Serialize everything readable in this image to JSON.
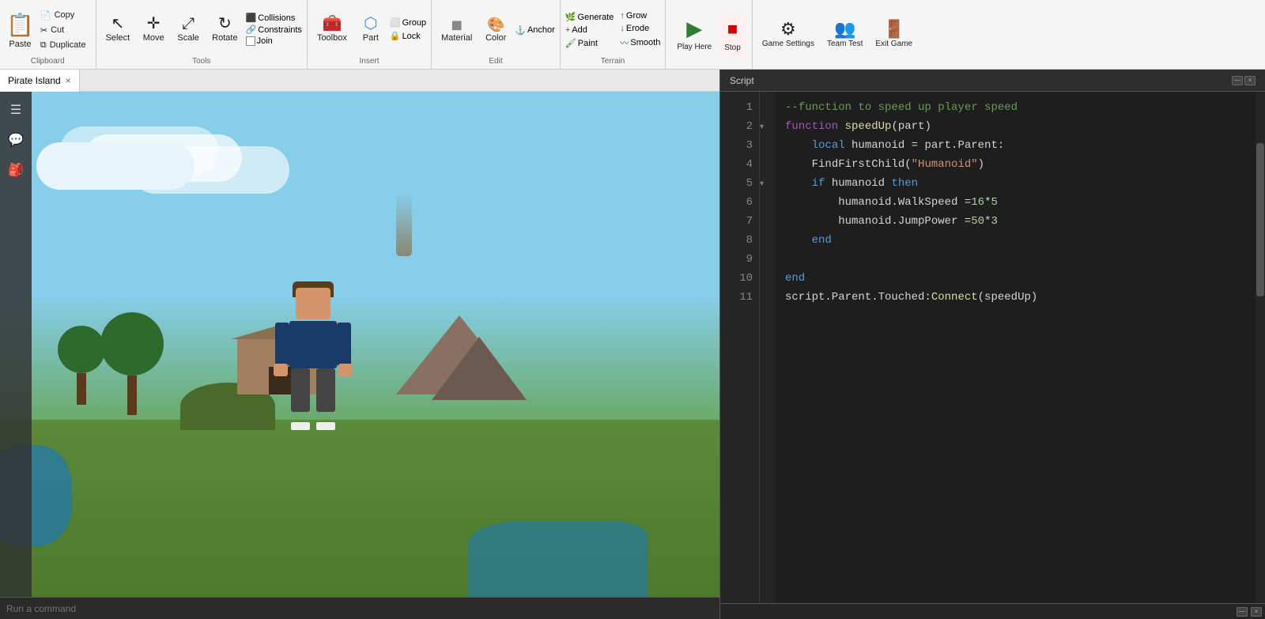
{
  "toolbar": {
    "clipboard": {
      "label": "Clipboard",
      "paste": "Paste",
      "copy": "Copy",
      "cut": "Cut",
      "duplicate": "Duplicate"
    },
    "tools": {
      "label": "Tools",
      "select": "Select",
      "move": "Move",
      "scale": "Scale",
      "rotate": "Rotate",
      "collisions": "Collisions",
      "constraints": "Constraints",
      "join": "Join"
    },
    "insert": {
      "label": "Insert",
      "toolbox": "Toolbox",
      "part": "Part",
      "group": "Group",
      "lock": "Lock"
    },
    "edit": {
      "label": "Edit",
      "material": "Material",
      "color": "Color",
      "anchor": "Anchor"
    },
    "terrain": {
      "label": "Terrain",
      "generate": "Generate",
      "grow": "Grow",
      "add": "Add",
      "erode": "Erode",
      "paint": "Paint",
      "smooth": "Smooth"
    },
    "play": {
      "play_here": "Play Here",
      "stop": "Stop",
      "game_settings": "Game Settings",
      "team_test": "Team Test",
      "exit_game": "Exit Game"
    }
  },
  "tab": {
    "name": "Pirate Island",
    "close": "×"
  },
  "viewport": {
    "sidebar_icons": [
      "☰",
      "💬",
      "🎒"
    ]
  },
  "script_panel": {
    "title": "Script",
    "lines": [
      {
        "num": 1,
        "fold": false,
        "content": "--function to speed up player speed",
        "type": "comment"
      },
      {
        "num": 2,
        "fold": true,
        "content": "function speedUp(part)",
        "type": "function_decl"
      },
      {
        "num": 3,
        "fold": false,
        "content": "    local humanoid = part.Parent:",
        "type": "code"
      },
      {
        "num": 4,
        "fold": false,
        "content": "    FindFirstChild(\"Humanoid\")",
        "type": "code_string"
      },
      {
        "num": 5,
        "fold": true,
        "content": "    if humanoid then",
        "type": "if"
      },
      {
        "num": 6,
        "fold": false,
        "content": "        humanoid.WalkSpeed = 16*5",
        "type": "code_num"
      },
      {
        "num": 7,
        "fold": false,
        "content": "        humanoid.JumpPower = 50*3",
        "type": "code_num"
      },
      {
        "num": 8,
        "fold": false,
        "content": "    end",
        "type": "end"
      },
      {
        "num": 9,
        "fold": false,
        "content": "",
        "type": "empty"
      },
      {
        "num": 10,
        "fold": false,
        "content": "end",
        "type": "end"
      },
      {
        "num": 11,
        "fold": false,
        "content": "script.Parent.Touched:Connect(speedUp)",
        "type": "code"
      }
    ]
  },
  "command_bar": {
    "placeholder": "Run a command"
  }
}
